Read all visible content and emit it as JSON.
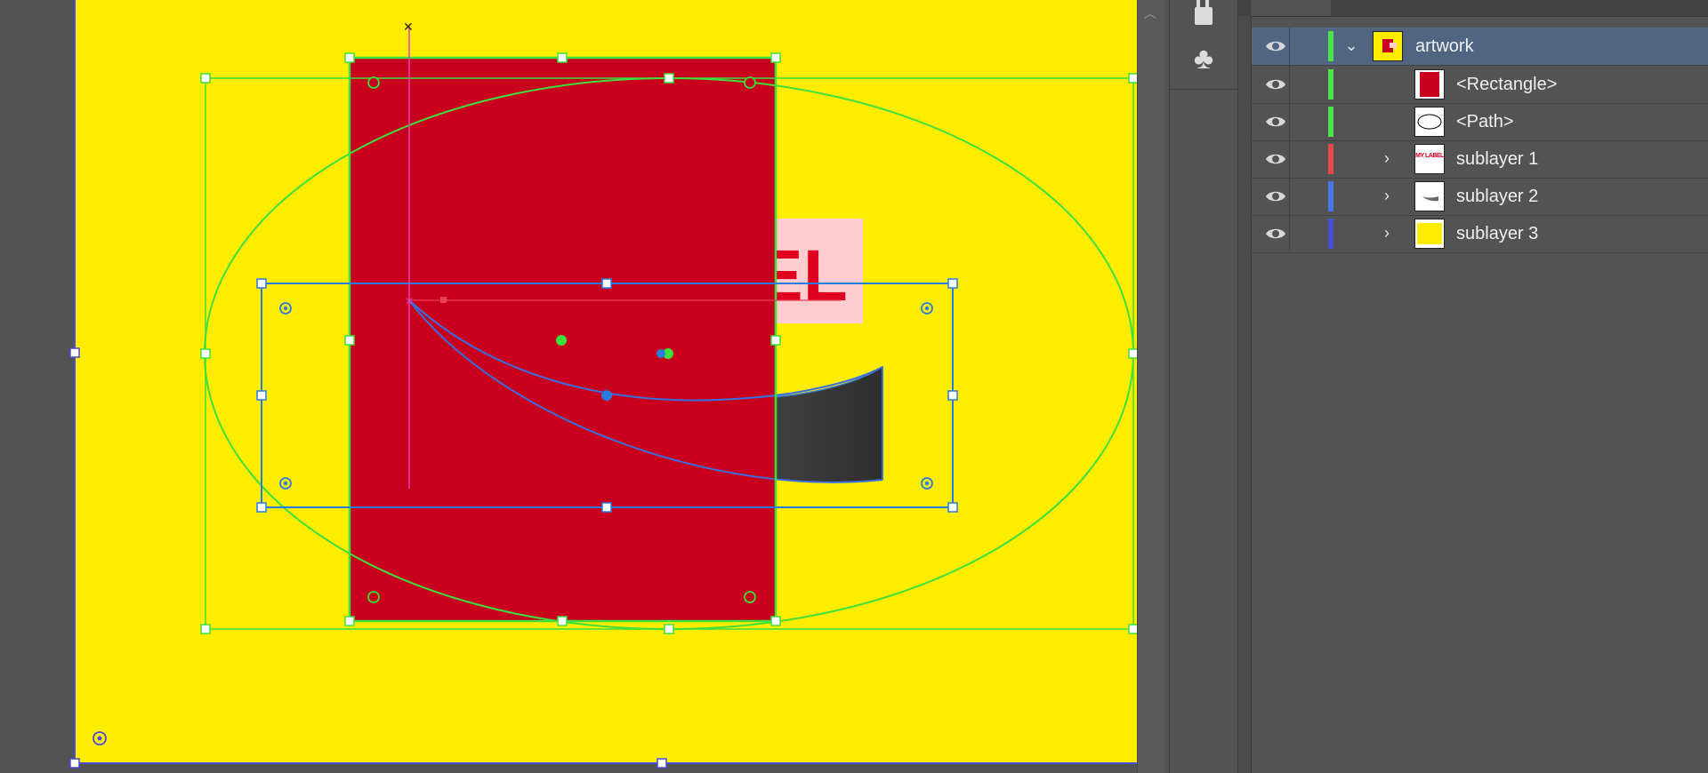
{
  "canvas": {
    "artboard_color": "#FFED00",
    "rectangle_color": "#C8001E",
    "label_fragment": "EL",
    "label_box_color": "#FFCCD0",
    "label_text_color": "#E00020",
    "selection_green": "#3DE03D",
    "selection_blue": "#2A7BE0"
  },
  "toolstrip": {
    "icons": [
      "brush-pot-icon",
      "club-icon"
    ]
  },
  "layers": {
    "rows": [
      {
        "name": "artwork",
        "color": "#49E349",
        "expanded": true,
        "thumb": "artwork"
      },
      {
        "name": "<Rectangle>",
        "color": "#49E349",
        "thumb": "rectangle"
      },
      {
        "name": "<Path>",
        "color": "#49E349",
        "thumb": "path"
      },
      {
        "name": "sublayer 1",
        "color": "#E84A4A",
        "thumb": "label",
        "thumb_text": "MY LABEL"
      },
      {
        "name": "sublayer 2",
        "color": "#4A78E8",
        "thumb": "shape"
      },
      {
        "name": "sublayer 3",
        "color": "#4A4ADB",
        "thumb": "yellow"
      }
    ]
  }
}
